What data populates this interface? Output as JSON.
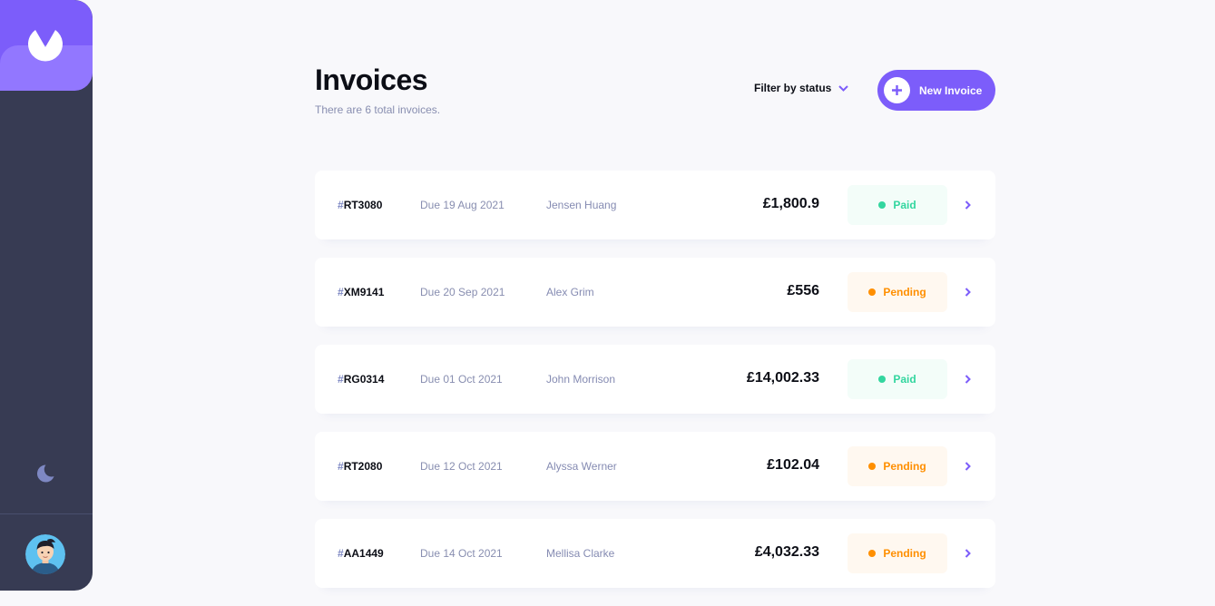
{
  "sidebar": {
    "logo_icon": "app-logo",
    "theme_toggle_icon": "moon-icon",
    "avatar": "user-avatar"
  },
  "header": {
    "title": "Invoices",
    "subtitle": "There are 6 total invoices.",
    "filter_label": "Filter by status",
    "new_invoice_label": "New Invoice"
  },
  "invoices": [
    {
      "hash": "#",
      "id": "RT3080",
      "due": "Due 19 Aug 2021",
      "client": "Jensen Huang",
      "amount": "£1,800.9",
      "status": "Paid",
      "status_key": "paid"
    },
    {
      "hash": "#",
      "id": "XM9141",
      "due": "Due 20 Sep 2021",
      "client": "Alex Grim",
      "amount": "£556",
      "status": "Pending",
      "status_key": "pending"
    },
    {
      "hash": "#",
      "id": "RG0314",
      "due": "Due 01 Oct 2021",
      "client": "John Morrison",
      "amount": "£14,002.33",
      "status": "Paid",
      "status_key": "paid"
    },
    {
      "hash": "#",
      "id": "RT2080",
      "due": "Due 12 Oct 2021",
      "client": "Alyssa Werner",
      "amount": "£102.04",
      "status": "Pending",
      "status_key": "pending"
    },
    {
      "hash": "#",
      "id": "AA1449",
      "due": "Due 14 Oct 2021",
      "client": "Mellisa Clarke",
      "amount": "£4,032.33",
      "status": "Pending",
      "status_key": "pending"
    }
  ],
  "colors": {
    "accent": "#7c5dfa",
    "sidebar": "#373b53",
    "paid": "#33d69f",
    "pending": "#ff8f00"
  }
}
